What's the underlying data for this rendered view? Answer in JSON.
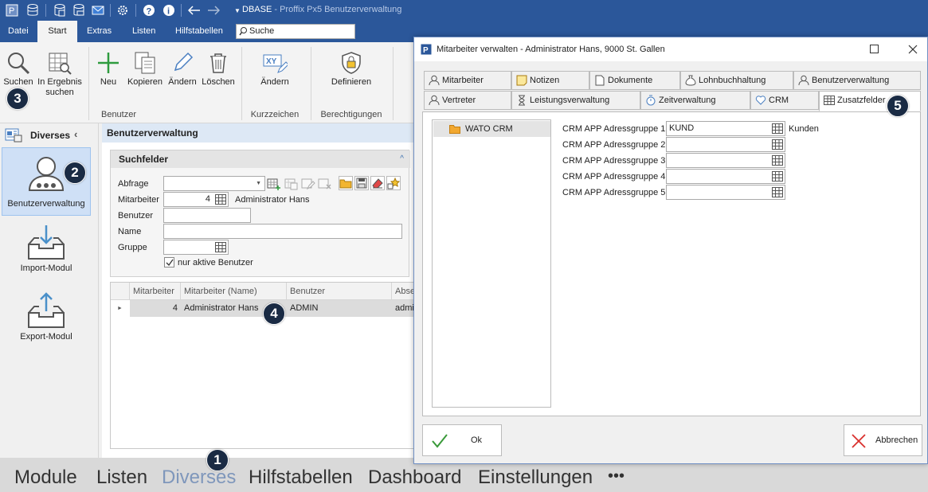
{
  "app": {
    "db_label": "DBASE",
    "title": "Proffix Px5 Benutzerverwaltung"
  },
  "menu": {
    "tabs": [
      "Datei",
      "Start",
      "Extras",
      "Listen",
      "Hilfstabellen"
    ],
    "search_placeholder": "Suche"
  },
  "ribbon": {
    "suchen": "Suchen",
    "in_ergebnis_1": "In Ergebnis",
    "in_ergebnis_2": "suchen",
    "neu": "Neu",
    "kopieren": "Kopieren",
    "aendern": "Ändern",
    "loeschen": "Löschen",
    "kurz_aendern": "Ändern",
    "definieren": "Definieren",
    "group_benutzer": "Benutzer",
    "group_kurzzeichen": "Kurzzeichen",
    "group_berechtigungen": "Berechtigungen"
  },
  "leftnav": {
    "header": "Diverses",
    "items": [
      "Benutzerverwaltung",
      "Import-Modul",
      "Export-Modul"
    ]
  },
  "main": {
    "header": "Benutzerverwaltung",
    "suchfelder": "Suchfelder",
    "labels": {
      "abfrage": "Abfrage",
      "mitarbeiter": "Mitarbeiter",
      "benutzer": "Benutzer",
      "name": "Name",
      "gruppe": "Gruppe"
    },
    "mitarbeiter_value": "4",
    "mitarbeiter_name": "Administrator Hans",
    "nur_aktive": "nur aktive Benutzer",
    "grid": {
      "columns": [
        "Mitarbeiter",
        "Mitarbeiter (Name)",
        "Benutzer",
        "Abse"
      ],
      "row": [
        "4",
        "Administrator Hans",
        "ADMIN",
        "admi"
      ]
    }
  },
  "bottom_nav": [
    "Module",
    "Listen",
    "Diverses",
    "Hilfstabellen",
    "Dashboard",
    "Einstellungen",
    "•••"
  ],
  "dialog": {
    "title": "Mitarbeiter verwalten - Administrator Hans, 9000 St. Gallen",
    "tabs_row1": [
      "Mitarbeiter",
      "Notizen",
      "Dokumente",
      "Lohnbuchhaltung",
      "Benutzerverwaltung"
    ],
    "tabs_row2": [
      "Vertreter",
      "Leistungsverwaltung",
      "Zeitverwaltung",
      "CRM",
      "Zusatzfelder"
    ],
    "tree_item": "WATO CRM",
    "crm_fields": [
      {
        "label": "CRM APP Adressgruppe 1",
        "value": "KUND",
        "desc": "Kunden"
      },
      {
        "label": "CRM APP Adressgruppe 2",
        "value": "",
        "desc": ""
      },
      {
        "label": "CRM APP Adressgruppe 3",
        "value": "",
        "desc": ""
      },
      {
        "label": "CRM APP Adressgruppe 4",
        "value": "",
        "desc": ""
      },
      {
        "label": "CRM APP Adressgruppe 5",
        "value": "",
        "desc": ""
      }
    ],
    "ok": "Ok",
    "abbrechen": "Abbrechen"
  },
  "badges": [
    "1",
    "2",
    "3",
    "4",
    "5"
  ],
  "colors": {
    "titlebar": "#2b579a",
    "selection": "#cfe0f6",
    "badge": "#1a2b44",
    "cancel_x": "#d9302c",
    "ok_check": "#3a9a3a"
  }
}
